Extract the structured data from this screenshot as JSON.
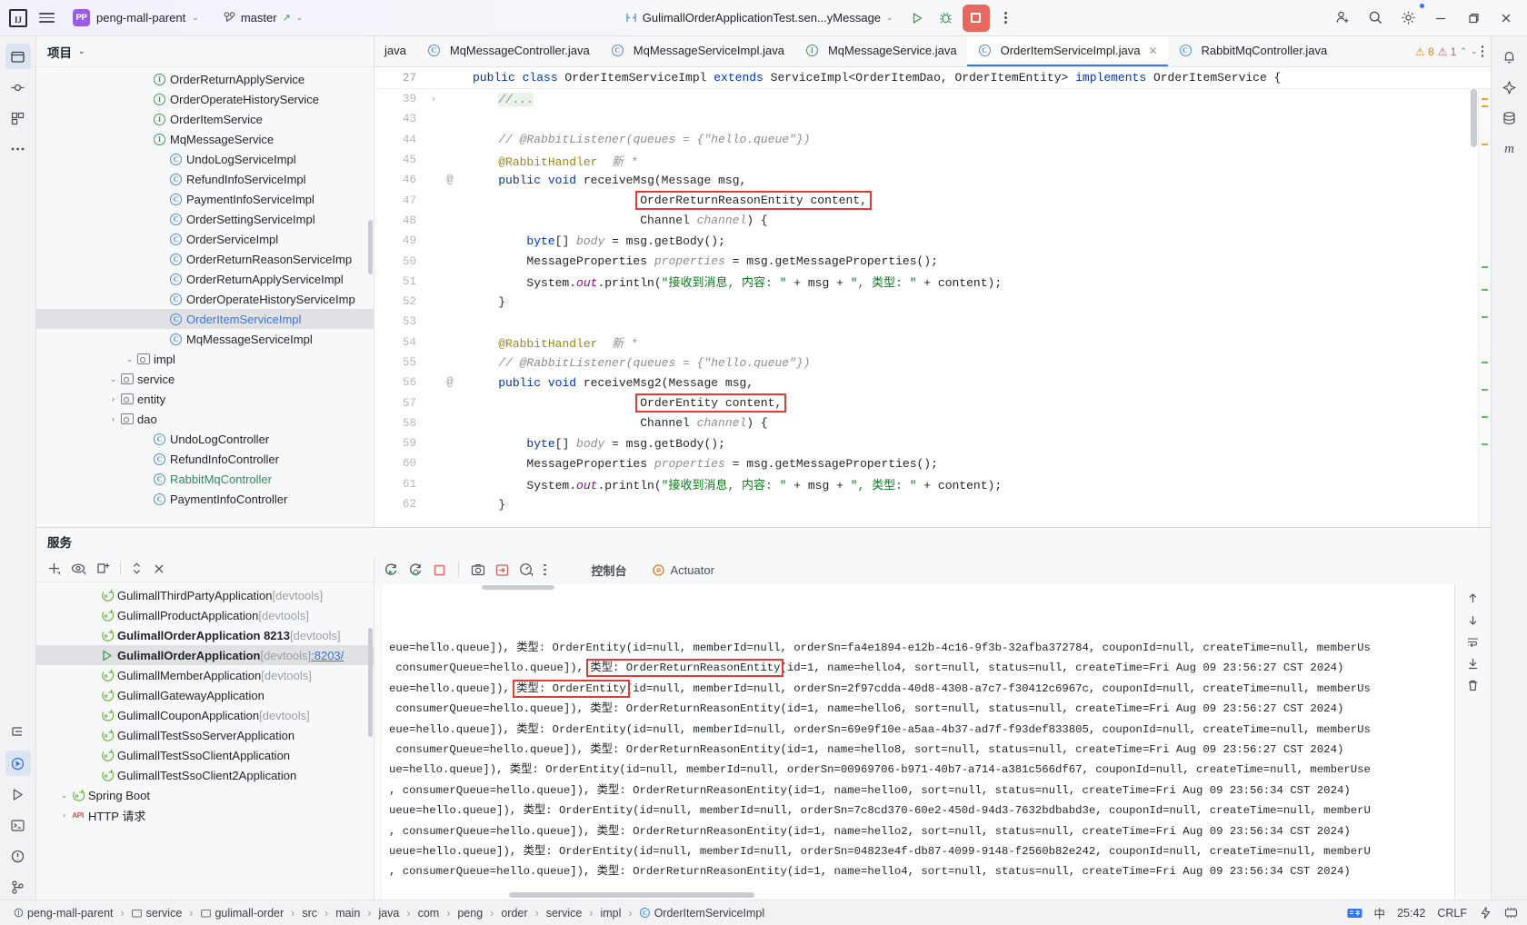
{
  "titlebar": {
    "logo": "IJ",
    "project_name": "peng-mall-parent",
    "project_initials": "PP",
    "branch": "master",
    "run_config": "GulimallOrderApplicationTest.sen...yMessage",
    "buttons": {
      "run": "run-icon",
      "debug": "debug-icon",
      "stop": "stop-icon",
      "more": "more-vertical-icon",
      "share": "add-user-icon",
      "search": "search-icon",
      "settings": "settings-icon",
      "minimize": "minimize-icon",
      "maximize": "maximize-icon",
      "close": "close-icon"
    }
  },
  "project_tool": {
    "title": "项目",
    "items": [
      {
        "label": "PaymentInfoController",
        "icon": "class",
        "indent": 6,
        "arrow": "",
        "color": "normal"
      },
      {
        "label": "RabbitMqController",
        "icon": "class",
        "indent": 6,
        "arrow": "",
        "color": "green"
      },
      {
        "label": "RefundInfoController",
        "icon": "class",
        "indent": 6,
        "arrow": "",
        "color": "normal"
      },
      {
        "label": "UndoLogController",
        "icon": "class",
        "indent": 6,
        "arrow": "",
        "color": "normal"
      },
      {
        "label": "dao",
        "icon": "folder",
        "indent": 4,
        "arrow": "right",
        "color": "normal"
      },
      {
        "label": "entity",
        "icon": "folder",
        "indent": 4,
        "arrow": "right",
        "color": "normal"
      },
      {
        "label": "service",
        "icon": "folder",
        "indent": 4,
        "arrow": "down",
        "color": "normal"
      },
      {
        "label": "impl",
        "icon": "folder",
        "indent": 5,
        "arrow": "down",
        "color": "normal"
      },
      {
        "label": "MqMessageServiceImpl",
        "icon": "class",
        "indent": 7,
        "arrow": "",
        "color": "normal"
      },
      {
        "label": "OrderItemServiceImpl",
        "icon": "class",
        "indent": 7,
        "arrow": "",
        "color": "blue",
        "selected": true
      },
      {
        "label": "OrderOperateHistoryServiceImp",
        "icon": "class",
        "indent": 7,
        "arrow": "",
        "color": "normal"
      },
      {
        "label": "OrderReturnApplyServiceImpl",
        "icon": "class",
        "indent": 7,
        "arrow": "",
        "color": "normal"
      },
      {
        "label": "OrderReturnReasonServiceImp",
        "icon": "class",
        "indent": 7,
        "arrow": "",
        "color": "normal"
      },
      {
        "label": "OrderServiceImpl",
        "icon": "class",
        "indent": 7,
        "arrow": "",
        "color": "normal"
      },
      {
        "label": "OrderSettingServiceImpl",
        "icon": "class",
        "indent": 7,
        "arrow": "",
        "color": "normal"
      },
      {
        "label": "PaymentInfoServiceImpl",
        "icon": "class",
        "indent": 7,
        "arrow": "",
        "color": "normal"
      },
      {
        "label": "RefundInfoServiceImpl",
        "icon": "class",
        "indent": 7,
        "arrow": "",
        "color": "normal"
      },
      {
        "label": "UndoLogServiceImpl",
        "icon": "class",
        "indent": 7,
        "arrow": "",
        "color": "normal"
      },
      {
        "label": "MqMessageService",
        "icon": "interface",
        "indent": 6,
        "arrow": "",
        "color": "normal"
      },
      {
        "label": "OrderItemService",
        "icon": "interface",
        "indent": 6,
        "arrow": "",
        "color": "normal"
      },
      {
        "label": "OrderOperateHistoryService",
        "icon": "interface",
        "indent": 6,
        "arrow": "",
        "color": "normal"
      },
      {
        "label": "OrderReturnApplyService",
        "icon": "interface",
        "indent": 6,
        "arrow": "",
        "color": "normal"
      }
    ]
  },
  "editor": {
    "tabs": [
      {
        "label": "java",
        "icon": "",
        "active": false,
        "clipped": true
      },
      {
        "label": "MqMessageController.java",
        "icon": "class",
        "active": false
      },
      {
        "label": "MqMessageServiceImpl.java",
        "icon": "class",
        "active": false
      },
      {
        "label": "MqMessageService.java",
        "icon": "interface",
        "active": false
      },
      {
        "label": "OrderItemServiceImpl.java",
        "icon": "class",
        "active": true,
        "closable": true
      },
      {
        "label": "RabbitMqController.java",
        "icon": "class",
        "active": false
      }
    ],
    "sticky_header": {
      "line": "27",
      "text": "public class OrderItemServiceImpl extends ServiceImpl<OrderItemDao, OrderItemEntity> implements OrderItemService {"
    },
    "inspections": {
      "warnings": "8",
      "errors": "1"
    },
    "lines": [
      {
        "n": "39",
        "fold": "›",
        "html": "    <span class=\"cmt line-hl\">//...</span>"
      },
      {
        "n": "43",
        "fold": "",
        "html": ""
      },
      {
        "n": "44",
        "fold": "",
        "html": "    <span class=\"cmt\">// @RabbitListener(queues = {\"hello.queue\"})</span>"
      },
      {
        "n": "45",
        "fold": "",
        "html": "    <span class=\"ann\">@RabbitHandler</span>  <span class=\"cmt\">新 *</span>"
      },
      {
        "n": "46",
        "fold": "@",
        "html": "    <span class=\"kw\">public</span> <span class=\"kw\">void</span> receiveMsg(Message msg,"
      },
      {
        "n": "47",
        "fold": "",
        "html": "                        <span class=\"hl-box\">OrderReturnReasonEntity content,</span>"
      },
      {
        "n": "48",
        "fold": "",
        "html": "                        Channel <span class=\"param\">channel</span>) {"
      },
      {
        "n": "49",
        "fold": "",
        "html": "        <span class=\"kw\">byte</span>[] <span class=\"param\">body</span> = msg.getBody();"
      },
      {
        "n": "50",
        "fold": "",
        "html": "        MessageProperties <span class=\"param\">properties</span> = msg.getMessageProperties();"
      },
      {
        "n": "51",
        "fold": "",
        "html": "        System.<span class=\"stat\">out</span>.println(<span class=\"str\">\"接收到消息, 内容: \"</span> + msg + <span class=\"str\">\", 类型: \"</span> + content);"
      },
      {
        "n": "52",
        "fold": "",
        "html": "    }"
      },
      {
        "n": "53",
        "fold": "",
        "html": ""
      },
      {
        "n": "54",
        "fold": "",
        "html": "    <span class=\"ann\">@RabbitHandler</span>  <span class=\"cmt\">新 *</span>"
      },
      {
        "n": "55",
        "fold": "",
        "html": "    <span class=\"cmt\">// @RabbitListener(queues = {\"hello.queue\"})</span>"
      },
      {
        "n": "56",
        "fold": "@",
        "html": "    <span class=\"kw\">public</span> <span class=\"kw\">void</span> receiveMsg2(Message msg,"
      },
      {
        "n": "57",
        "fold": "",
        "html": "                        <span class=\"hl-box\">OrderEntity content,</span>"
      },
      {
        "n": "58",
        "fold": "",
        "html": "                        Channel <span class=\"param\">channel</span>) {"
      },
      {
        "n": "59",
        "fold": "",
        "html": "        <span class=\"kw\">byte</span>[] <span class=\"param\">body</span> = msg.getBody();"
      },
      {
        "n": "60",
        "fold": "",
        "html": "        MessageProperties <span class=\"param\">properties</span> = msg.getMessageProperties();"
      },
      {
        "n": "61",
        "fold": "",
        "html": "        System.<span class=\"stat\">out</span>.println(<span class=\"str\">\"接收到消息, 内容: \"</span> + msg + <span class=\"str\">\", 类型: \"</span> + content);"
      },
      {
        "n": "62",
        "fold": "",
        "html": "    }"
      }
    ]
  },
  "services": {
    "title": "服务",
    "toolbar": [
      "add-icon",
      "eye-icon",
      "new-tab-icon",
      "expand-collapse-icon",
      "close-icon"
    ],
    "items": [
      {
        "label": "HTTP 请求",
        "icon": "api",
        "indent": 1,
        "arrow": "right"
      },
      {
        "label": "Spring Boot",
        "icon": "spring",
        "indent": 1,
        "arrow": "down"
      },
      {
        "label": "GulimallTestSsoClient2Application",
        "icon": "spring",
        "indent": 3,
        "arrow": ""
      },
      {
        "label": "GulimallTestSsoClientApplication",
        "icon": "spring",
        "indent": 3,
        "arrow": ""
      },
      {
        "label": "GulimallTestSsoServerApplication",
        "icon": "spring",
        "indent": 3,
        "arrow": ""
      },
      {
        "label": "GulimallCouponApplication",
        "suffix": "[devtools]",
        "icon": "spring",
        "indent": 3,
        "arrow": ""
      },
      {
        "label": "GulimallGatewayApplication",
        "icon": "spring",
        "indent": 3,
        "arrow": ""
      },
      {
        "label": "GulimallMemberApplication",
        "suffix": "[devtools]",
        "icon": "spring",
        "indent": 3,
        "arrow": ""
      },
      {
        "label": "GulimallOrderApplication",
        "suffix": "[devtools]",
        "port": ":8203/",
        "icon": "running",
        "indent": 3,
        "arrow": "",
        "selected": true,
        "bold": true
      },
      {
        "label": "GulimallOrderApplication 8213",
        "suffix": "[devtools]",
        "icon": "spring",
        "indent": 3,
        "arrow": "",
        "bold": true
      },
      {
        "label": "GulimallProductApplication",
        "suffix": "[devtools]",
        "icon": "spring",
        "indent": 3,
        "arrow": ""
      },
      {
        "label": "GulimallThirdPartyApplication",
        "suffix": "[devtools]",
        "icon": "spring",
        "indent": 3,
        "arrow": ""
      }
    ]
  },
  "console": {
    "toolbar_icons": [
      "rerun-icon",
      "rerun-debug-icon",
      "stop-icon",
      "camera-icon",
      "export-icon",
      "profiler-icon",
      "more-vertical-icon"
    ],
    "tabs": [
      {
        "label": "控制台",
        "active": true,
        "icon": ""
      },
      {
        "label": "Actuator",
        "active": false,
        "icon": "actuator"
      }
    ],
    "side_icons": [
      "scroll-up-icon",
      "scroll-down-icon",
      "soft-wrap-icon",
      "scroll-end-icon",
      "trash-icon"
    ],
    "lines": [
      {
        "pre": "eue=hello.queue]), 类型: OrderEntity(id=null, memberId=null, orderSn=fa4e1894-e12b-4c16-9f3b-32afba372784, couponId=null, createTime=null, memberUs",
        "hl": null,
        "post": ""
      },
      {
        "pre": " consumerQueue=hello.queue]), ",
        "hl": "类型: OrderReturnReasonEntity",
        "post": "(id=1, name=hello4, sort=null, status=null, createTime=Fri Aug 09 23:56:27 CST 2024)"
      },
      {
        "pre": "eue=hello.queue]), ",
        "hl": "类型: OrderEntity",
        "post": "(id=null, memberId=null, orderSn=2f97cdda-40d8-4308-a7c7-f30412c6967c, couponId=null, createTime=null, memberUs"
      },
      {
        "pre": " consumerQueue=hello.queue]), 类型: OrderReturnReasonEntity(id=1, name=hello6, sort=null, status=null, createTime=Fri Aug 09 23:56:27 CST 2024)",
        "hl": null,
        "post": ""
      },
      {
        "pre": "eue=hello.queue]), 类型: OrderEntity(id=null, memberId=null, orderSn=69e9f10e-a5aa-4b37-ad7f-f93def833805, couponId=null, createTime=null, memberUs",
        "hl": null,
        "post": ""
      },
      {
        "pre": " consumerQueue=hello.queue]), 类型: OrderReturnReasonEntity(id=1, name=hello8, sort=null, status=null, createTime=Fri Aug 09 23:56:27 CST 2024)",
        "hl": null,
        "post": ""
      },
      {
        "pre": "ue=hello.queue]), 类型: OrderEntity(id=null, memberId=null, orderSn=00969706-b971-40b7-a714-a381c566df67, couponId=null, createTime=null, memberUse",
        "hl": null,
        "post": ""
      },
      {
        "pre": ", consumerQueue=hello.queue]), 类型: OrderReturnReasonEntity(id=1, name=hello0, sort=null, status=null, createTime=Fri Aug 09 23:56:34 CST 2024)",
        "hl": null,
        "post": ""
      },
      {
        "pre": "ueue=hello.queue]), 类型: OrderEntity(id=null, memberId=null, orderSn=7c8cd370-60e2-450d-94d3-7632bdbabd3e, couponId=null, createTime=null, memberU",
        "hl": null,
        "post": ""
      },
      {
        "pre": ", consumerQueue=hello.queue]), 类型: OrderReturnReasonEntity(id=1, name=hello2, sort=null, status=null, createTime=Fri Aug 09 23:56:34 CST 2024)",
        "hl": null,
        "post": ""
      },
      {
        "pre": "ueue=hello.queue]), 类型: OrderEntity(id=null, memberId=null, orderSn=04823e4f-db87-4099-9148-f2560b82e242, couponId=null, createTime=null, memberU",
        "hl": null,
        "post": ""
      },
      {
        "pre": ", consumerQueue=hello.queue]), 类型: OrderReturnReasonEntity(id=1, name=hello4, sort=null, status=null, createTime=Fri Aug 09 23:56:34 CST 2024)",
        "hl": null,
        "post": ""
      }
    ]
  },
  "statusbar": {
    "crumbs": [
      {
        "label": "peng-mall-parent",
        "icon": "module"
      },
      {
        "label": "service",
        "icon": "folder"
      },
      {
        "label": "gulimall-order",
        "icon": "folder"
      },
      {
        "label": "src",
        "icon": ""
      },
      {
        "label": "main",
        "icon": ""
      },
      {
        "label": "java",
        "icon": ""
      },
      {
        "label": "com",
        "icon": ""
      },
      {
        "label": "peng",
        "icon": ""
      },
      {
        "label": "order",
        "icon": ""
      },
      {
        "label": "service",
        "icon": ""
      },
      {
        "label": "impl",
        "icon": ""
      },
      {
        "label": "OrderItemServiceImpl",
        "icon": "class"
      }
    ],
    "caret": "25:42",
    "line_sep": "CRLF",
    "ime": "中"
  },
  "colors": {
    "accent": "#3574f0",
    "highlight_red": "#e53935",
    "run_green": "#3a9c4e",
    "stop_red": "#e8675f",
    "purple_badge": "#9b5de5"
  }
}
